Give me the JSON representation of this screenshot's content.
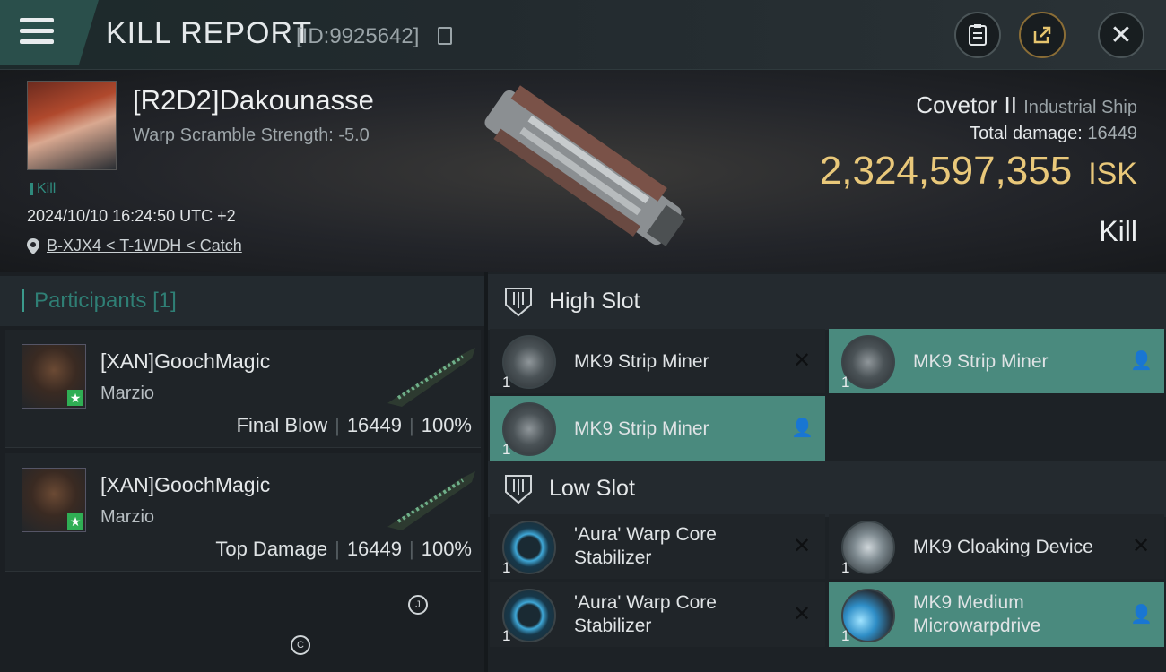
{
  "header": {
    "title": "KILL REPORT",
    "kill_id": "[ID:9925642]"
  },
  "victim": {
    "name": "[R2D2]Dakounasse",
    "warp_scramble": "Warp Scramble Strength: -5.0",
    "tag": "Kill",
    "timestamp": "2024/10/10 16:24:50 UTC +2",
    "location": "B-XJX4 < T-1WDH < Catch",
    "ship_name": "Covetor II",
    "ship_class": "Industrial Ship",
    "total_damage_label": "Total damage:",
    "total_damage": "16449",
    "isk_value": "2,324,597,355",
    "isk_unit": "ISK",
    "result": "Kill"
  },
  "participants": {
    "label": "Participants",
    "count": "[1]",
    "rows": [
      {
        "name": "[XAN]GoochMagic",
        "corp": "Marzio",
        "role": "Final Blow",
        "damage": "16449",
        "percent": "100%"
      },
      {
        "name": "[XAN]GoochMagic",
        "corp": "Marzio",
        "role": "Top Damage",
        "damage": "16449",
        "percent": "100%"
      }
    ],
    "misc_circles": [
      "J",
      "C"
    ]
  },
  "slots": {
    "high_label": "High Slot",
    "low_label": "Low Slot",
    "high_items": [
      {
        "qty": "1",
        "name": "MK9 Strip Miner",
        "state": "destroyed"
      },
      {
        "qty": "1",
        "name": "MK9 Strip Miner",
        "state": "dropped"
      },
      {
        "qty": "1",
        "name": "MK9 Strip Miner",
        "state": "dropped"
      }
    ],
    "low_items": [
      {
        "qty": "1",
        "name_line1": "'Aura' Warp Core",
        "name_line2": "Stabilizer",
        "state": "destroyed"
      },
      {
        "qty": "1",
        "name_line1": "MK9 Cloaking Device",
        "name_line2": "",
        "state": "destroyed"
      },
      {
        "qty": "1",
        "name_line1": "'Aura' Warp Core",
        "name_line2": "Stabilizer",
        "state": "destroyed"
      },
      {
        "qty": "1",
        "name_line1": "MK9 Medium",
        "name_line2": "Microwarpdrive",
        "state": "dropped"
      }
    ]
  },
  "colors": {
    "accent_teal": "#4a8a7e",
    "isk_gold": "#e9c87a",
    "share_orange": "#e6c56e"
  }
}
